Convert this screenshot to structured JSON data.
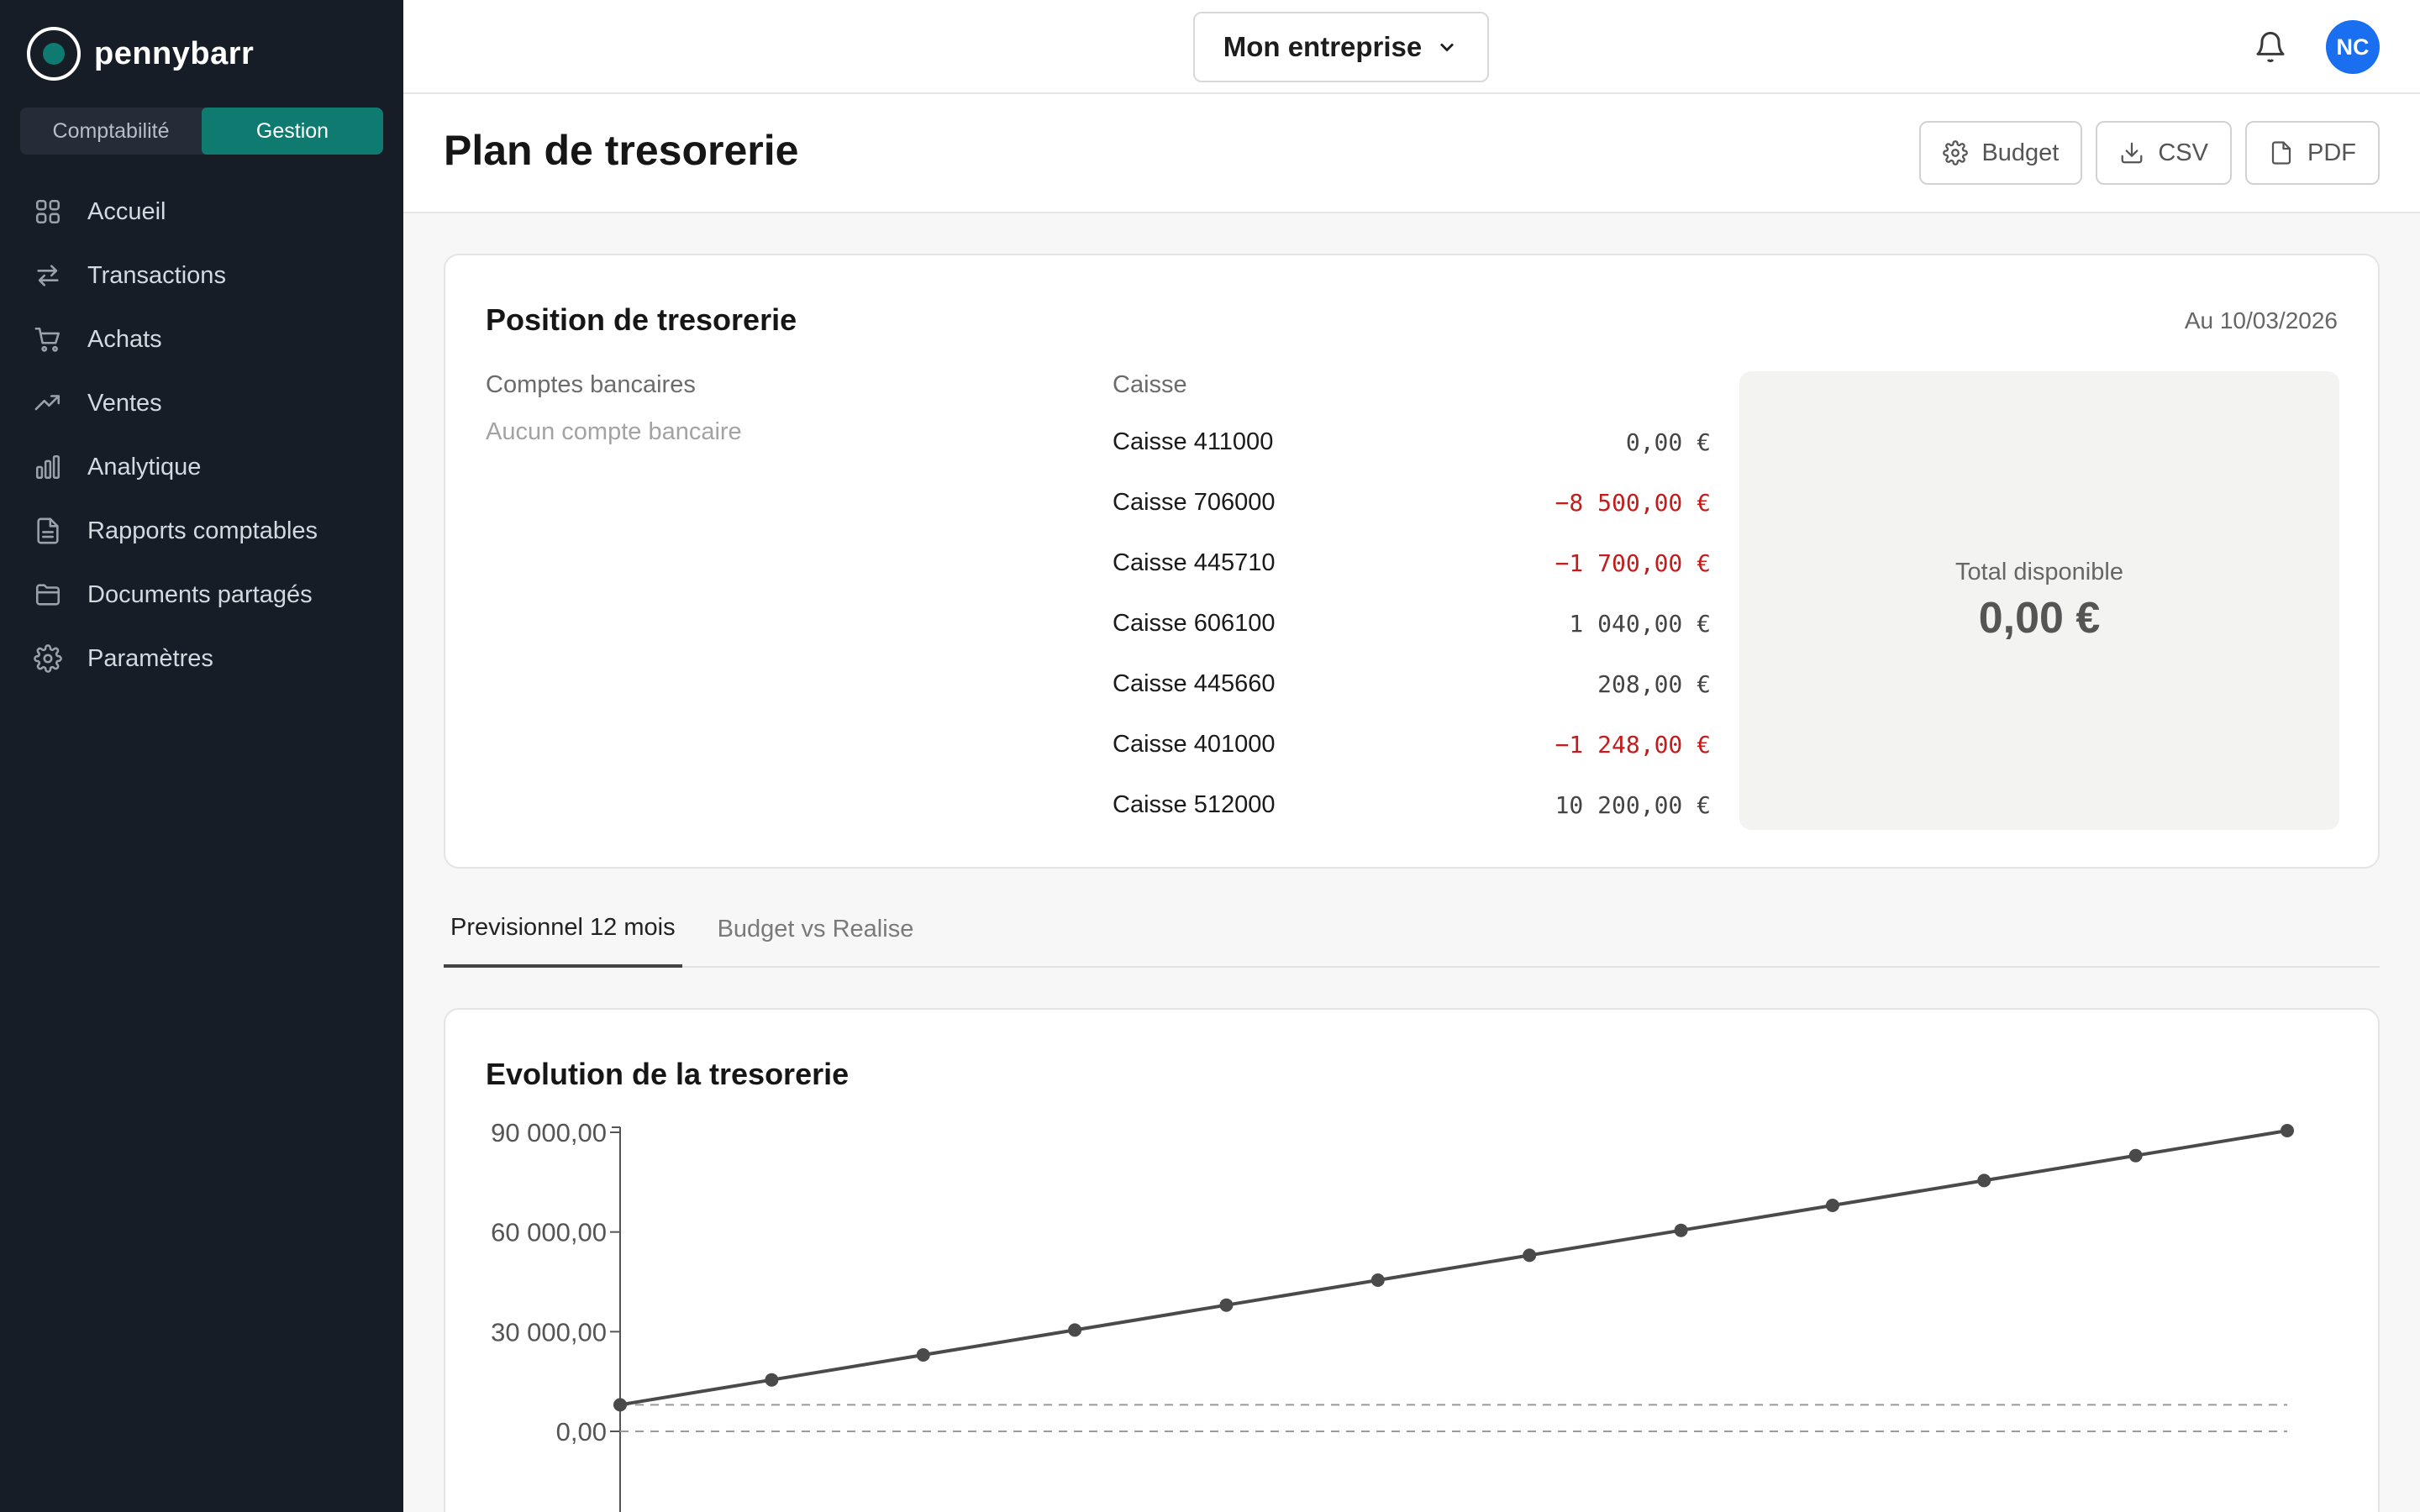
{
  "app": {
    "brand": "pennybarr",
    "switch": {
      "left": "Comptabilité",
      "right": "Gestion",
      "active": "right"
    }
  },
  "sidebar": {
    "items": [
      {
        "label": "Accueil",
        "icon": "grid-icon"
      },
      {
        "label": "Transactions",
        "icon": "arrows-icon"
      },
      {
        "label": "Achats",
        "icon": "cart-icon"
      },
      {
        "label": "Ventes",
        "icon": "trend-up-icon"
      },
      {
        "label": "Analytique",
        "icon": "bar-chart-icon"
      },
      {
        "label": "Rapports comptables",
        "icon": "file-icon"
      },
      {
        "label": "Documents partagés",
        "icon": "folder-icon"
      },
      {
        "label": "Paramètres",
        "icon": "gear-icon"
      }
    ]
  },
  "topbar": {
    "company": "Mon entreprise",
    "avatar": "NC"
  },
  "page": {
    "title": "Plan de tresorerie",
    "actions": {
      "budget": "Budget",
      "csv": "CSV",
      "pdf": "PDF"
    }
  },
  "position": {
    "title": "Position de tresorerie",
    "date": "Au 10/03/2026",
    "bank_header": "Comptes bancaires",
    "bank_empty": "Aucun compte bancaire",
    "cash_header": "Caisse",
    "cash_rows": [
      {
        "name": "Caisse 411000",
        "amount": "0,00 €",
        "negative": false
      },
      {
        "name": "Caisse 706000",
        "amount": "−8 500,00 €",
        "negative": true
      },
      {
        "name": "Caisse 445710",
        "amount": "−1 700,00 €",
        "negative": true
      },
      {
        "name": "Caisse 606100",
        "amount": "1 040,00 €",
        "negative": false
      },
      {
        "name": "Caisse 445660",
        "amount": "208,00 €",
        "negative": false
      },
      {
        "name": "Caisse 401000",
        "amount": "−1 248,00 €",
        "negative": true
      },
      {
        "name": "Caisse 512000",
        "amount": "10 200,00 €",
        "negative": false
      }
    ],
    "total_label": "Total disponible",
    "total_value": "0,00 €"
  },
  "tabs": [
    {
      "label": "Previsionnel 12 mois",
      "active": true
    },
    {
      "label": "Budget vs Realise",
      "active": false
    }
  ],
  "chart": {
    "title": "Evolution de la tresorerie"
  },
  "chart_data": {
    "type": "line",
    "title": "Evolution de la tresorerie",
    "y_tick_labels": [
      "0,00",
      "30 000,00",
      "60 000,00",
      "90 000,00"
    ],
    "y_tick_values": [
      0,
      30000,
      60000,
      90000
    ],
    "ylim": [
      -25000,
      91000
    ],
    "x": [
      1,
      2,
      3,
      4,
      5,
      6,
      7,
      8,
      9,
      10,
      11,
      12
    ],
    "series": [
      {
        "values": [
          8000,
          15500,
          23000,
          30500,
          38000,
          45500,
          53000,
          60500,
          68000,
          75500,
          83000,
          90500
        ]
      }
    ],
    "reference_lines": [
      8000,
      0
    ],
    "grid": false,
    "colors": {
      "line": "#4a4a4a",
      "reference": "#9a9a9a"
    }
  }
}
